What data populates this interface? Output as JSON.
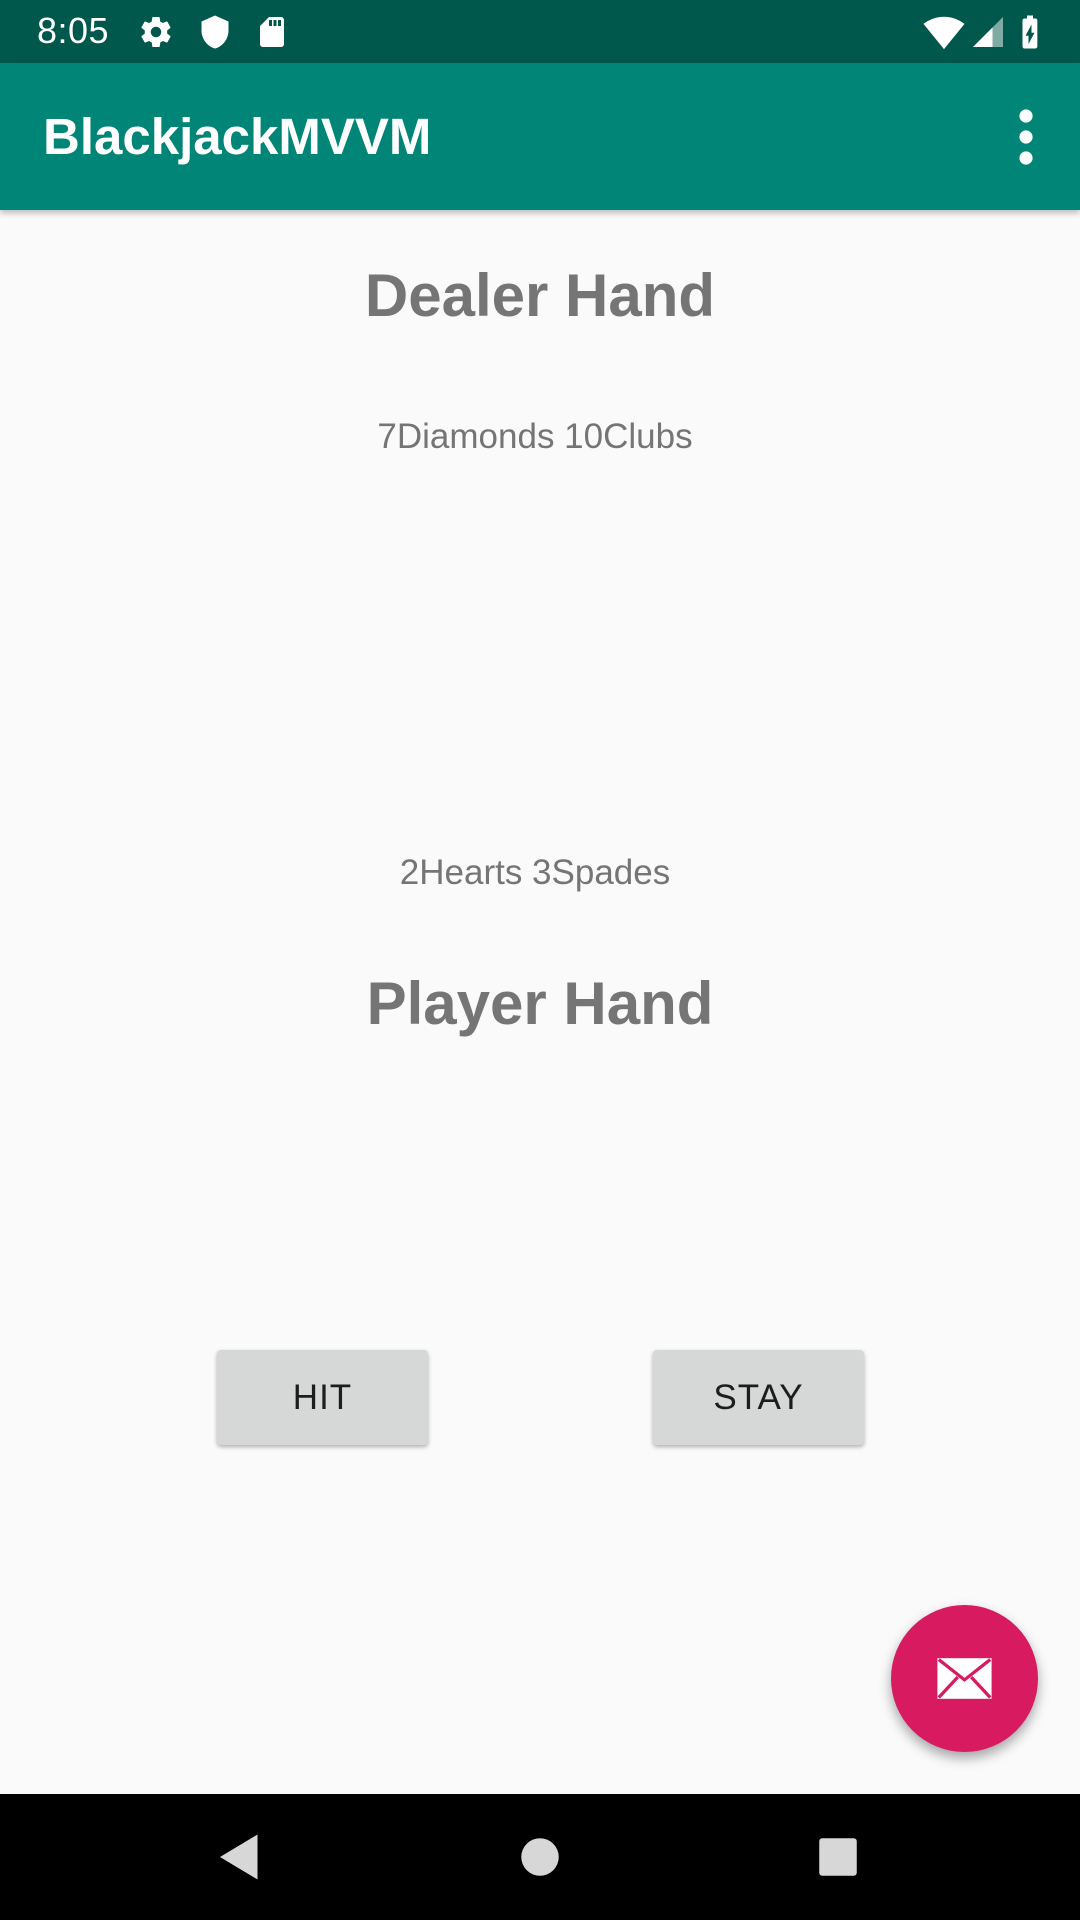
{
  "status_bar": {
    "time": "8:05",
    "left_icons": [
      "settings-icon",
      "shield-icon",
      "sd-card-icon"
    ],
    "right_icons": [
      "wifi-icon",
      "cell-signal-icon",
      "battery-charging-icon"
    ]
  },
  "app_bar": {
    "title": "BlackjackMVVM",
    "menu_icon": "more-vert-icon"
  },
  "dealer": {
    "title": "Dealer Hand",
    "cards": "7Diamonds 10Clubs"
  },
  "player": {
    "cards": "2Hearts 3Spades",
    "title": "Player Hand"
  },
  "actions": {
    "hit_label": "HIT",
    "stay_label": "STAY"
  },
  "fab": {
    "icon": "email-icon",
    "color": "#d81b60"
  },
  "nav_bar": {
    "buttons": [
      "back-icon",
      "home-icon",
      "recents-icon"
    ]
  },
  "colors": {
    "primary": "#008577",
    "primary_dark": "#00574b",
    "accent": "#d81b60"
  }
}
